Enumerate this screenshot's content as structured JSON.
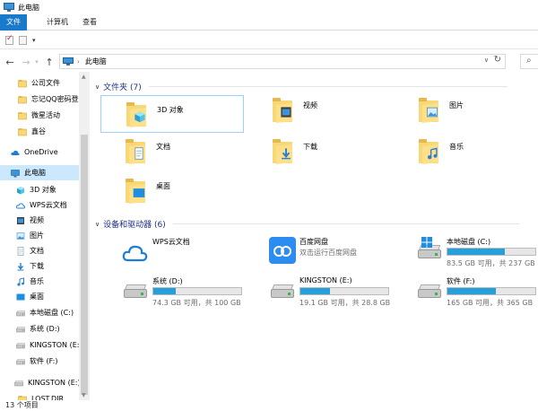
{
  "window": {
    "title": "此电脑"
  },
  "ribbon": {
    "tabs": [
      "文件",
      "计算机",
      "查看"
    ]
  },
  "quick_access": {
    "arrow": "▾"
  },
  "address": {
    "crumb": "此电脑",
    "separator": "›"
  },
  "sidebar": {
    "items": [
      {
        "label": "公司文件",
        "icon": "folder-icon"
      },
      {
        "label": "忘记QQ密码登应",
        "icon": "folder-icon"
      },
      {
        "label": "微星活动",
        "icon": "folder-icon"
      },
      {
        "label": "鑫谷",
        "icon": "folder-icon"
      },
      {
        "label": "OneDrive",
        "icon": "cloud-icon"
      },
      {
        "label": "此电脑",
        "icon": "computer-icon"
      },
      {
        "label": "3D 对象",
        "icon": "cube-icon"
      },
      {
        "label": "WPS云文档",
        "icon": "wps-cloud-icon"
      },
      {
        "label": "视频",
        "icon": "video-icon"
      },
      {
        "label": "图片",
        "icon": "pictures-icon"
      },
      {
        "label": "文档",
        "icon": "documents-icon"
      },
      {
        "label": "下载",
        "icon": "download-icon"
      },
      {
        "label": "音乐",
        "icon": "music-icon"
      },
      {
        "label": "桌面",
        "icon": "desktop-icon"
      },
      {
        "label": "本地磁盘 (C:)",
        "icon": "drive-icon"
      },
      {
        "label": "系统 (D:)",
        "icon": "drive-icon"
      },
      {
        "label": "KINGSTON (E:)",
        "icon": "drive-icon"
      },
      {
        "label": "软件 (F:)",
        "icon": "drive-icon"
      },
      {
        "label": "KINGSTON (E:)",
        "icon": "usb-drive-icon"
      },
      {
        "label": "LOST.DIR",
        "icon": "folder-icon"
      }
    ]
  },
  "main": {
    "folders_header": "文件夹 (7)",
    "folders": [
      {
        "label": "3D 对象",
        "icon": "cube-icon"
      },
      {
        "label": "视频",
        "icon": "video-icon"
      },
      {
        "label": "图片",
        "icon": "pictures-icon"
      },
      {
        "label": "文档",
        "icon": "documents-icon"
      },
      {
        "label": "下载",
        "icon": "download-icon"
      },
      {
        "label": "音乐",
        "icon": "music-icon"
      },
      {
        "label": "桌面",
        "icon": "desktop-icon"
      }
    ],
    "devices_header": "设备和驱动器 (6)",
    "devices": [
      {
        "name": "WPS云文档",
        "kind": "app",
        "icon": "wps-cloud-icon"
      },
      {
        "name": "百度网盘",
        "kind": "app",
        "sub": "双击运行百度网盘",
        "icon": "baidu-netdisk-icon"
      },
      {
        "name": "本地磁盘 (C:)",
        "kind": "drive",
        "free": "83.5 GB 可用，共 237 GB",
        "used_fraction": 0.65,
        "icon": "windows-drive-icon"
      },
      {
        "name": "系统 (D:)",
        "kind": "drive",
        "free": "74.3 GB 可用，共 100 GB",
        "used_fraction": 0.26,
        "icon": "drive-icon"
      },
      {
        "name": "KINGSTON (E:)",
        "kind": "drive",
        "free": "19.1 GB 可用，共 28.8 GB",
        "used_fraction": 0.34,
        "icon": "drive-icon"
      },
      {
        "name": "软件 (F:)",
        "kind": "drive",
        "free": "165 GB 可用，共 365 GB",
        "used_fraction": 0.55,
        "icon": "drive-icon"
      }
    ]
  },
  "status": {
    "text": "13 个项目"
  },
  "colors": {
    "accent": "#1979ca",
    "bar": "#26a0da",
    "selection": "#cce8ff",
    "header": "#1e3287"
  }
}
